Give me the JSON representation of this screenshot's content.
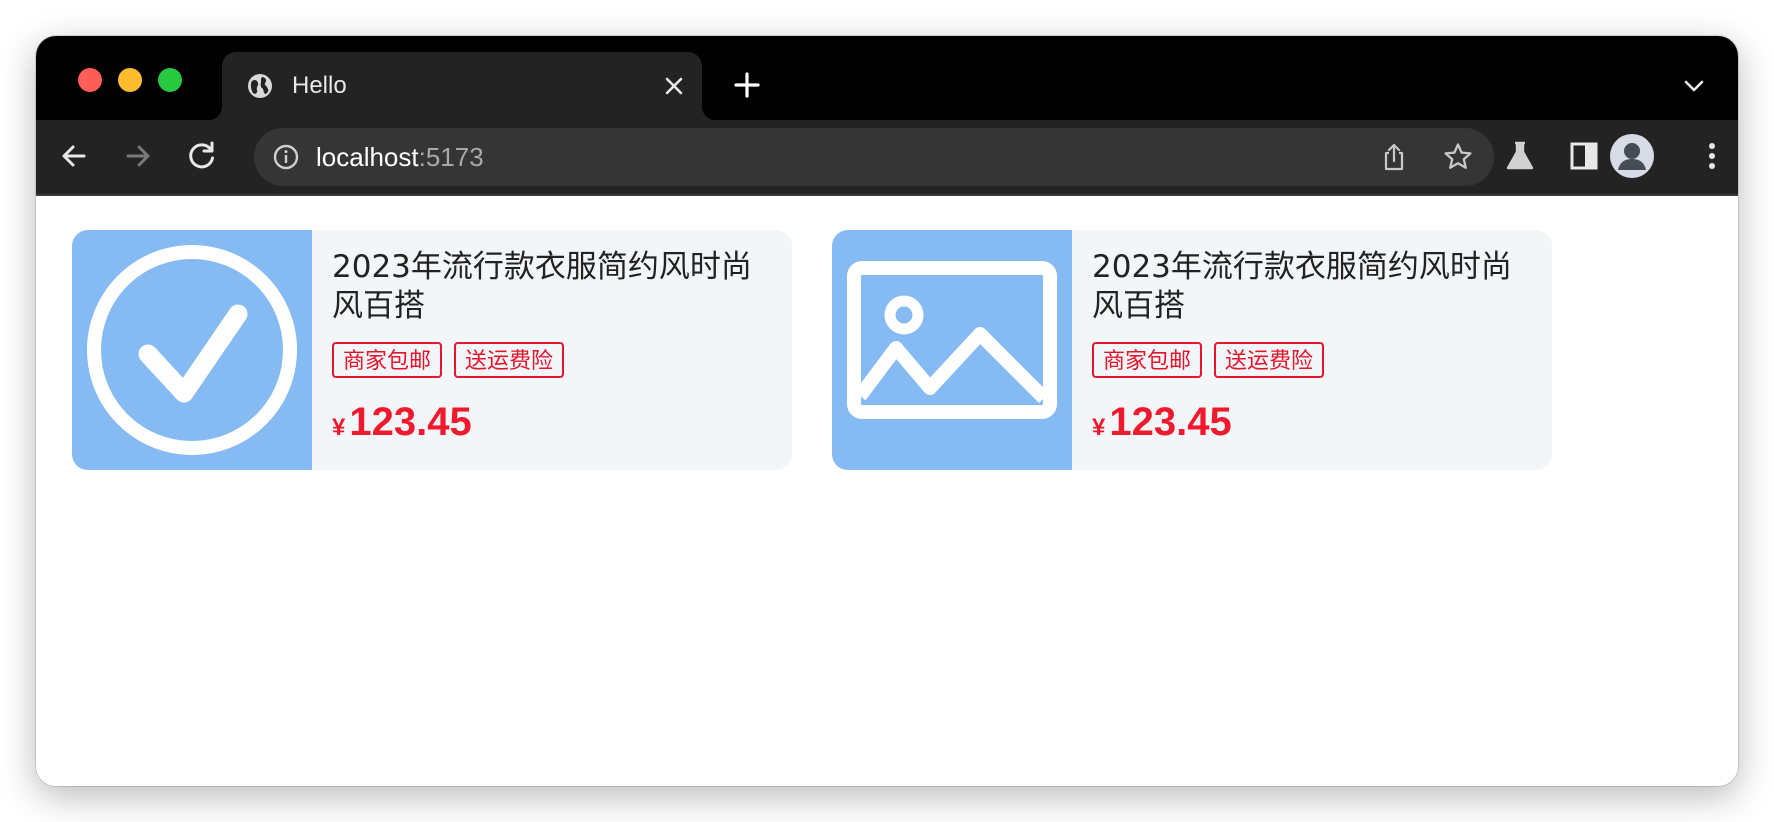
{
  "browser": {
    "tab": {
      "title": "Hello",
      "favicon": "globe-icon"
    },
    "address_bar": {
      "host": "localhost",
      "port": ":5173"
    },
    "icons": {
      "back": "arrow-left-icon",
      "forward": "arrow-right-icon",
      "reload": "reload-icon",
      "site_info": "info-icon",
      "share": "share-icon",
      "bookmark": "star-icon",
      "labs": "flask-icon",
      "side_panel": "side-panel-icon",
      "profile": "avatar-icon",
      "menu": "more-vert-icon",
      "new_tab": "plus-icon",
      "tab_search": "chevron-down-icon"
    }
  },
  "products": [
    {
      "image_icon": "check-circle-icon",
      "title": "2023年流行款衣服简约风时尚风百搭",
      "tags": [
        "商家包邮",
        "送运费险"
      ],
      "currency": "¥",
      "price": "123.45"
    },
    {
      "image_icon": "image-placeholder-icon",
      "title": "2023年流行款衣服简约风时尚风百搭",
      "tags": [
        "商家包邮",
        "送运费险"
      ],
      "currency": "¥",
      "price": "123.45"
    }
  ],
  "colors": {
    "thumbnail_bg": "#85baf2",
    "card_bg": "#f3f6f8",
    "price_red": "#f01a2e",
    "tag_red": "#e4142b"
  }
}
